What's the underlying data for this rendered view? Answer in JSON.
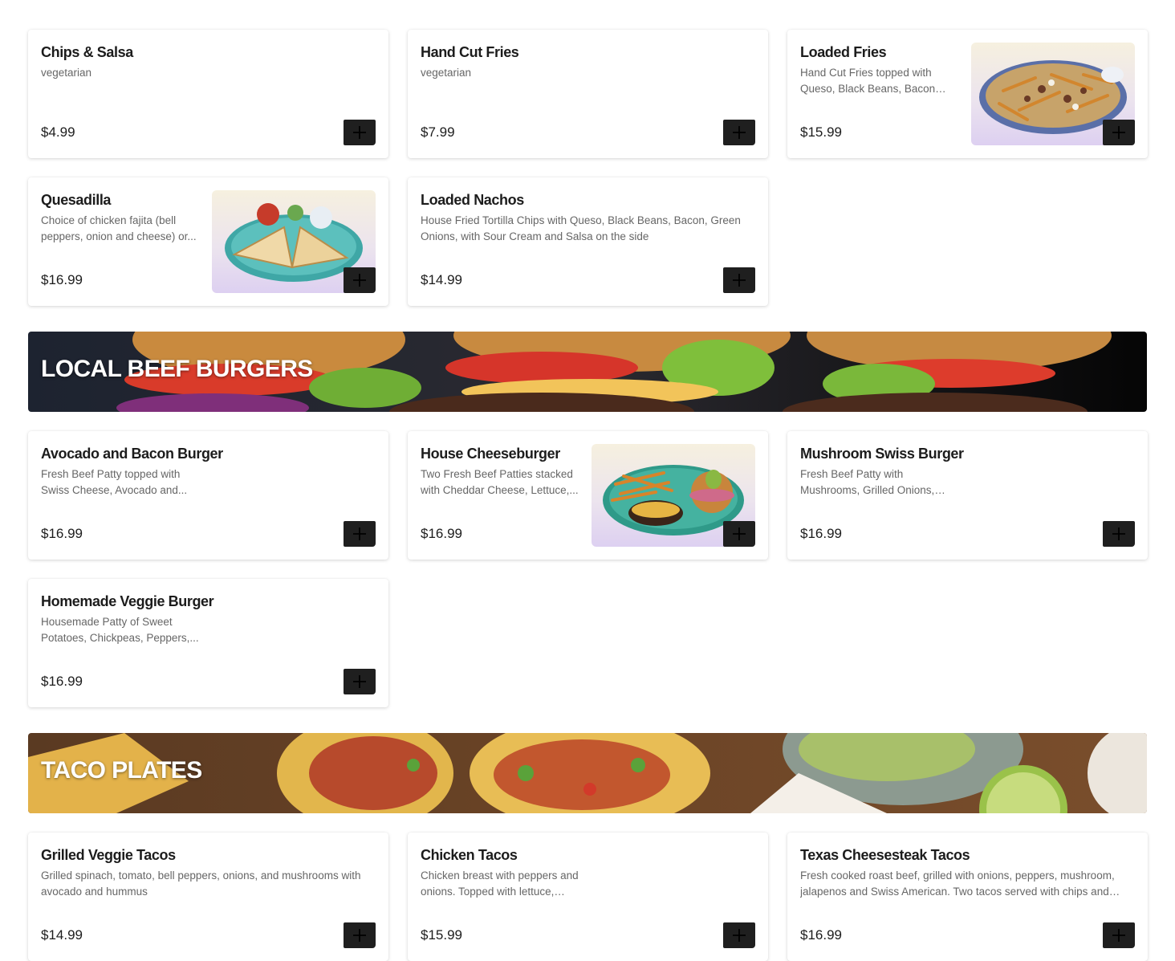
{
  "sections": {
    "appetizers": {
      "items": [
        {
          "name": "Chips & Salsa",
          "desc": "vegetarian",
          "price": "$4.99"
        },
        {
          "name": "Hand Cut Fries",
          "desc": "vegetarian",
          "price": "$7.99"
        },
        {
          "name": "Loaded Fries",
          "desc": "Hand Cut Fries topped with Queso, Black Beans, Bacon and...",
          "price": "$15.99"
        },
        {
          "name": "Quesadilla",
          "desc": "Choice of chicken fajita (bell peppers, onion and cheese) or...",
          "price": "$16.99"
        },
        {
          "name": "Loaded Nachos",
          "desc": "House Fried Tortilla Chips with Queso, Black Beans, Bacon, Green Onions, with Sour Cream and Salsa on the side",
          "price": "$14.99"
        }
      ]
    },
    "burgers": {
      "heading": "LOCAL BEEF BURGERS",
      "items": [
        {
          "name": "Avocado and Bacon Burger",
          "desc": "Fresh Beef Patty topped with Swiss Cheese, Avocado and...",
          "price": "$16.99"
        },
        {
          "name": "House Cheeseburger",
          "desc": "Two Fresh Beef Patties stacked with Cheddar Cheese, Lettuce,...",
          "price": "$16.99"
        },
        {
          "name": "Mushroom Swiss Burger",
          "desc": "Fresh Beef Patty with Mushrooms, Grilled Onions, Swiss, Lettuce an...",
          "price": "$16.99"
        },
        {
          "name": "Homemade Veggie Burger",
          "desc": "Housemade Patty of Sweet Potatoes, Chickpeas, Peppers,...",
          "price": "$16.99"
        }
      ]
    },
    "tacos": {
      "heading": "TACO PLATES",
      "items": [
        {
          "name": "Grilled Veggie Tacos",
          "desc": "Grilled spinach, tomato, bell peppers, onions, and mushrooms with avocado and hummus",
          "price": "$14.99"
        },
        {
          "name": "Chicken Tacos",
          "desc": "Chicken breast with peppers and onions. Topped with lettuce, pico...",
          "price": "$15.99"
        },
        {
          "name": "Texas Cheesesteak Tacos",
          "desc": "Fresh cooked roast beef, grilled with onions, peppers, mushroom, jalapenos and Swiss American. Two tacos served with chips and salsa...",
          "price": "$16.99"
        }
      ]
    }
  },
  "icons": {
    "add": "plus-icon"
  },
  "colors": {
    "button": "#1f1f1f",
    "text": "#1c1c1c",
    "muted": "#666666"
  }
}
